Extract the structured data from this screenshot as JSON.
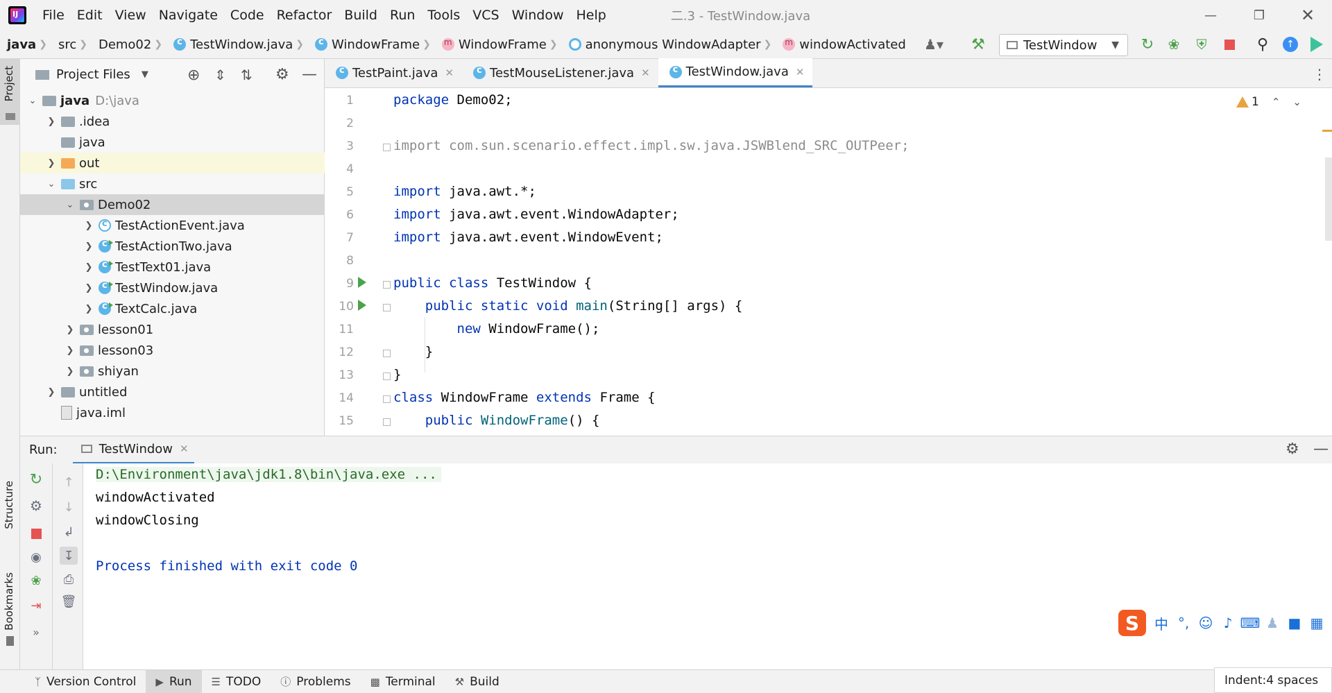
{
  "menubar": {
    "items": [
      "File",
      "Edit",
      "View",
      "Navigate",
      "Code",
      "Refactor",
      "Build",
      "Run",
      "Tools",
      "VCS",
      "Window",
      "Help"
    ],
    "window_title": "二.3 - TestWindow.java"
  },
  "breadcrumb": {
    "items": [
      "java",
      "src",
      "Demo02",
      "TestWindow.java",
      "WindowFrame",
      "WindowFrame",
      "anonymous WindowAdapter",
      "windowActivated"
    ]
  },
  "toolbar": {
    "run_config": "TestWindow"
  },
  "left_strip": {
    "project": "Project",
    "structure": "Structure",
    "bookmarks": "Bookmarks"
  },
  "project_panel": {
    "title": "Project Files",
    "tree": [
      {
        "label": "java",
        "hint": "D:\\java"
      },
      {
        "label": ".idea"
      },
      {
        "label": "java"
      },
      {
        "label": "out"
      },
      {
        "label": "src"
      },
      {
        "label": "Demo02"
      },
      {
        "label": "TestActionEvent.java"
      },
      {
        "label": "TestActionTwo.java"
      },
      {
        "label": "TestText01.java"
      },
      {
        "label": "TestWindow.java"
      },
      {
        "label": "TextCalc.java"
      },
      {
        "label": "lesson01"
      },
      {
        "label": "lesson03"
      },
      {
        "label": "shiyan"
      },
      {
        "label": "untitled"
      },
      {
        "label": "java.iml"
      }
    ]
  },
  "editor": {
    "tabs": [
      "TestPaint.java",
      "TestMouseListener.java",
      "TestWindow.java"
    ],
    "warning_count": "1",
    "line_numbers": [
      "1",
      "2",
      "3",
      "4",
      "5",
      "6",
      "7",
      "8",
      "9",
      "10",
      "11",
      "12",
      "13",
      "14",
      "15"
    ],
    "code": {
      "l1_kw": "package",
      "l1_rest": " Demo02;",
      "l3": "import com.sun.scenario.effect.impl.sw.java.JSWBlend_SRC_OUTPeer;",
      "l5_kw": "import",
      "l5_rest": " java.awt.*;",
      "l6_kw": "import",
      "l6_rest": " java.awt.event.WindowAdapter;",
      "l7_kw": "import",
      "l7_rest": " java.awt.event.WindowEvent;",
      "l9_kw": "public class",
      "l9_rest": " TestWindow {",
      "l10_indent": "    ",
      "l10_kw": "public static void",
      "l10_fn": " main",
      "l10_rest": "(String[] args) {",
      "l11_indent": "        ",
      "l11_kw": "new",
      "l11_rest": " WindowFrame();",
      "l12": "    }",
      "l13": "}",
      "l14_kw1": "class",
      "l14_mid": " WindowFrame ",
      "l14_kw2": "extends",
      "l14_rest": " Frame {",
      "l15_indent": "    ",
      "l15_kw": "public",
      "l15_fn": " WindowFrame",
      "l15_rest": "() {"
    }
  },
  "run_panel": {
    "label": "Run:",
    "tab": "TestWindow",
    "console": [
      "D:\\Environment\\java\\jdk1.8\\bin\\java.exe ...",
      "windowActivated",
      "windowClosing",
      "",
      "Process finished with exit code 0"
    ]
  },
  "bottom_bar": {
    "items": [
      "Version Control",
      "Run",
      "TODO",
      "Problems",
      "Terminal",
      "Build"
    ],
    "indent_status": "Indent:4 spaces"
  },
  "ime": {
    "logo": "S",
    "lang": "中"
  },
  "colors": {
    "keyword": "#0033b3",
    "function": "#00627a",
    "active_tab_underline": "#4083c9",
    "run_green": "#4aa24a",
    "stop_red": "#e55353"
  }
}
